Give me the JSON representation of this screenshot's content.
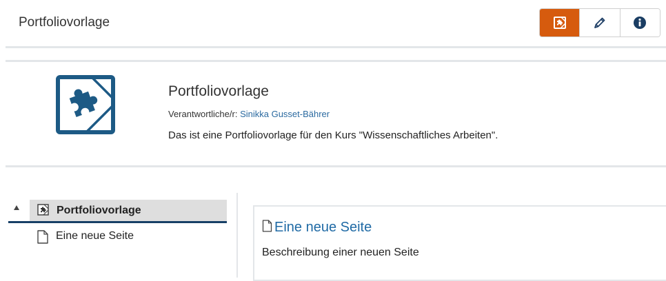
{
  "header": {
    "title": "Portfoliovorlage",
    "buttons": [
      {
        "icon": "portfolio-template-icon",
        "active": true
      },
      {
        "icon": "pencil-icon",
        "active": false
      },
      {
        "icon": "info-icon",
        "active": false
      }
    ]
  },
  "hero": {
    "icon": "puzzle-icon",
    "title": "Portfoliovorlage",
    "owner_label": "Verantwortliche/r:",
    "owner_name": "Sinikka Gusset-Bährer",
    "description": "Das ist eine Portfoliovorlage für den Kurs \"Wissenschaftliches Arbeiten\"."
  },
  "tree": {
    "root_label": "Portfoliovorlage",
    "child_label": "Eine neue Seite"
  },
  "page_card": {
    "title": "Eine neue Seite",
    "description": "Beschreibung einer neuen Seite"
  },
  "colors": {
    "accent": "#d65b0e",
    "link": "#1f6aa5",
    "hero_icon": "#1d5a85",
    "tree_selected_bar": "#173f66"
  }
}
